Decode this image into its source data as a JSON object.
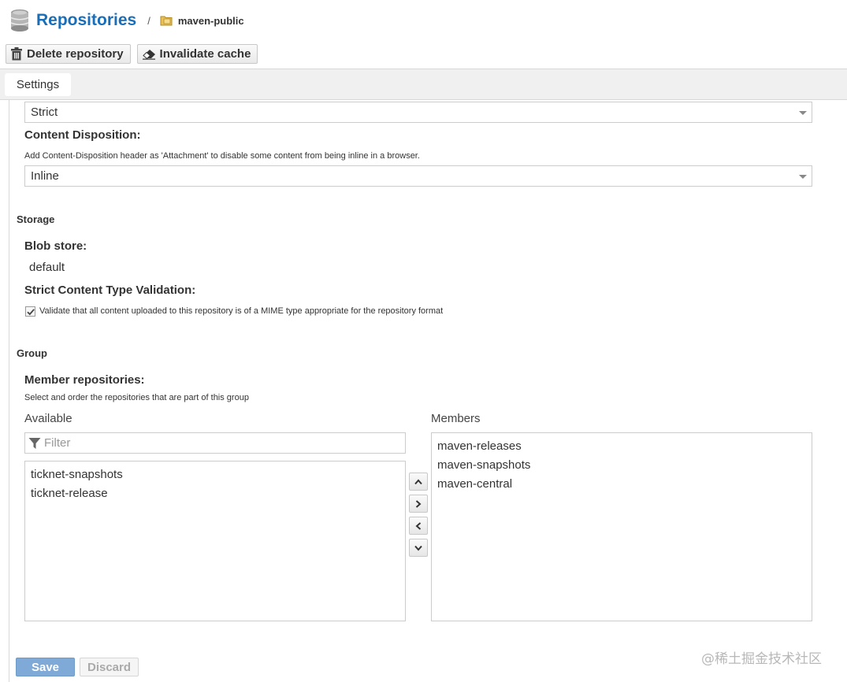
{
  "header": {
    "title": "Repositories",
    "separator": "/",
    "current_repo": "maven-public"
  },
  "toolbar": {
    "delete_label": "Delete repository",
    "invalidate_label": "Invalidate cache"
  },
  "tabs": [
    {
      "label": "Settings",
      "active": true
    }
  ],
  "form": {
    "strict_select_value": "Strict",
    "content_disposition": {
      "label": "Content Disposition:",
      "help": "Add Content-Disposition header as 'Attachment' to disable some content from being inline in a browser.",
      "value": "Inline"
    },
    "storage": {
      "section_title": "Storage",
      "blob_store_label": "Blob store:",
      "blob_store_value": "default",
      "strict_validation_label": "Strict Content Type Validation:",
      "strict_validation_checked": true,
      "strict_validation_text": "Validate that all content uploaded to this repository is of a MIME type appropriate for the repository format"
    },
    "group": {
      "section_title": "Group",
      "member_label": "Member repositories:",
      "member_help": "Select and order the repositories that are part of this group",
      "available_heading": "Available",
      "members_heading": "Members",
      "filter_placeholder": "Filter",
      "available": [
        "ticknet-snapshots",
        "ticknet-release"
      ],
      "members": [
        "maven-releases",
        "maven-snapshots",
        "maven-central"
      ]
    }
  },
  "actions": {
    "save_label": "Save",
    "discard_label": "Discard"
  },
  "watermark": "@稀土掘金技术社区",
  "colors": {
    "title_blue": "#1a6eb8",
    "save_button": "#7fa9d6"
  },
  "icons": {
    "header": "database-icon",
    "crumb": "folder-icon",
    "delete": "trash-icon",
    "invalidate": "eraser-icon",
    "filter": "funnel-icon"
  }
}
